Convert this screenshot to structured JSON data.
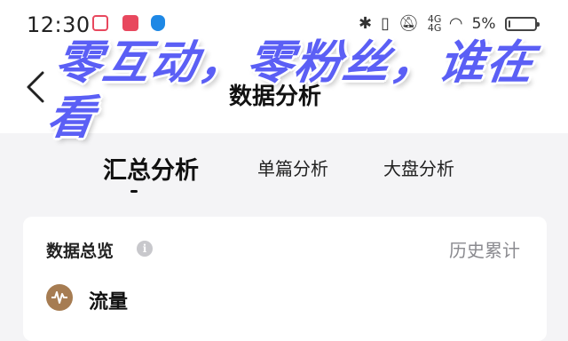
{
  "status_bar": {
    "time": "12:30",
    "icons": [
      "screen-record-icon",
      "shopping-bag-icon",
      "shield-icon",
      "bluetooth-icon",
      "vibrate-icon",
      "mute-icon",
      "signal-icon",
      "wifi-icon"
    ],
    "signal_1": "4G",
    "signal_2": "4G",
    "battery_percent": "5%",
    "battery_level": 0.05
  },
  "nav": {
    "back_icon": "chevron-left-icon",
    "title": "数据分析"
  },
  "overlay": {
    "caption": "零互动，零粉丝，谁在看",
    "color": "#5b5ff5"
  },
  "tabs": [
    {
      "label": "汇总分析",
      "active": true
    },
    {
      "label": "单篇分析",
      "active": false
    },
    {
      "label": "大盘分析",
      "active": false
    }
  ],
  "overview": {
    "title": "数据总览",
    "info_icon": "i",
    "history_label": "历史累计",
    "section_label": "流量",
    "section_icon": "waveform-icon",
    "section_icon_color": "#a67c52"
  }
}
